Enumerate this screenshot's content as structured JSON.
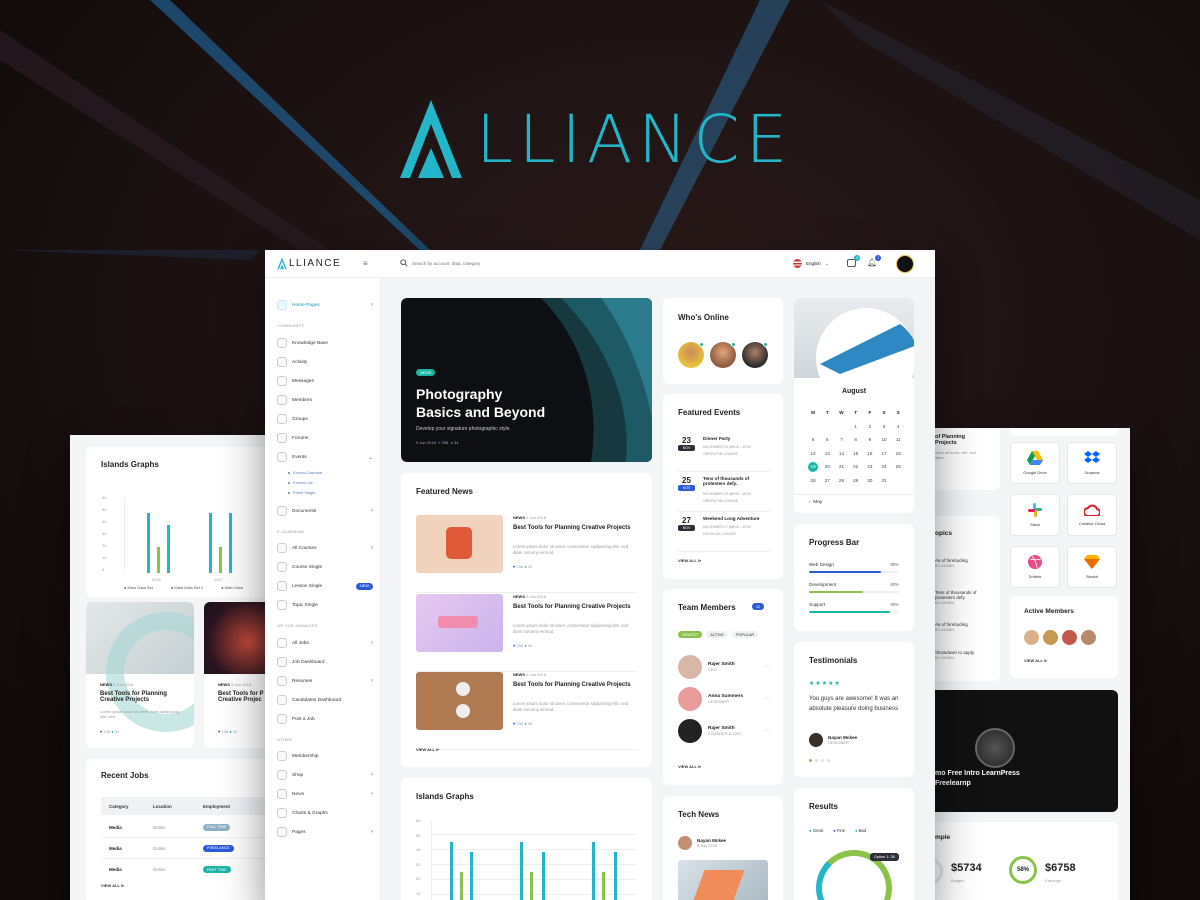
{
  "brand": {
    "name": "ALLIANCE",
    "accent": "#23b5c8"
  },
  "topbar": {
    "search_placeholder": "Search by account, data, category",
    "language": "English",
    "notif_badges": [
      "2",
      "1"
    ]
  },
  "sidebar": {
    "home": "Home Pages",
    "sections": [
      {
        "title": "COMMUNITY"
      },
      {
        "title": "E-LEARNING"
      },
      {
        "title": "WP JOB MANAGER"
      },
      {
        "title": "OTHER"
      }
    ],
    "community": [
      "Knowledge Base",
      "Activity",
      "Messages",
      "Members",
      "Groups",
      "Forums",
      "Events"
    ],
    "events_sub": [
      "Events Calendar",
      "Events List",
      "Event Single"
    ],
    "documents": "Documents",
    "elearning": [
      "All Courses",
      "Course Single",
      "Lesson Single",
      "Topic Single"
    ],
    "lesson_badge": "NEW",
    "jobs": [
      "All Jobs",
      "Job Dashboard",
      "Resumes",
      "Candidates Dashboard",
      "Post a Job"
    ],
    "other": [
      "Membership",
      "Shop",
      "News",
      "Charts & Graphs",
      "Pages"
    ]
  },
  "hero": {
    "tag": "NEWS",
    "title1": "Photography",
    "title2": "Basics and Beyond",
    "subtitle": "Develop your signature photographic style.",
    "date": "9 Jun 2018",
    "likes": "256",
    "comments": "34"
  },
  "featured_news": {
    "title": "Featured News",
    "items": [
      {
        "cat": "NEWS",
        "date": "9 Jun 2018",
        "title": "Best Tools for Planning Creative Projects",
        "text": "Lorem ipsum dolor sit amet, consectetur sadipscing elitr, sed diam nonumy eirmod.",
        "likes": "256",
        "comments": "34"
      },
      {
        "cat": "NEWS",
        "date": "9 Jun 2018",
        "title": "Best Tools for Planning Creative Projects",
        "text": "Lorem ipsum dolor sit amet, consectetur sadipscing elitr, sed diam nonumy eirmod.",
        "likes": "256",
        "comments": "34"
      },
      {
        "cat": "NEWS",
        "date": "9 Jun 2018",
        "title": "Best Tools for Planning Creative Projects",
        "text": "Lorem ipsum dolor sit amet, consectetur sadipscing elitr, sed diam nonumy eirmod.",
        "likes": "256",
        "comments": "36"
      }
    ],
    "view_all": "VIEW ALL"
  },
  "islands_graph": {
    "title": "Islands Graphs",
    "yticks": [
      "60",
      "50",
      "40",
      "30",
      "20",
      "10",
      "0"
    ]
  },
  "who_online": {
    "title": "Who's Online"
  },
  "featured_events": {
    "title": "Featured Events",
    "items": [
      {
        "day": "23",
        "mon": "NOV",
        "title": "Dinner Party",
        "meta1": "NOVEMBER 23 @8:00 - 10:00",
        "meta2": "GREEN PIN LOUNGE"
      },
      {
        "day": "25",
        "mon": "NOV",
        "title": "Tens of thousands of protesters defy.",
        "meta1": "NOVEMBER 25 @8:00 - 10:00",
        "meta2": "GREEN PIN LOUNGE"
      },
      {
        "day": "27",
        "mon": "NOV",
        "title": "Weekend Long Adventure",
        "meta1": "NOVEMBER 27 @8:00 - 10:00",
        "meta2": "DOUGLAS LOUNGE"
      }
    ],
    "view_all": "VIEW ALL"
  },
  "team": {
    "title": "Team Members",
    "count": "12",
    "tabs": [
      "NEWEST",
      "ACTIVE",
      "POPULAR"
    ],
    "members": [
      {
        "name": "Rajer Smith",
        "role": "CEO"
      },
      {
        "name": "Anna Summers",
        "role": "DESIGNER"
      },
      {
        "name": "Rajer Smith",
        "role": "FOUNDER & CEO"
      }
    ],
    "view_all": "VIEW ALL"
  },
  "tech_news": {
    "title": "Tech News",
    "author": "Nayan Mckee",
    "date": "9 Jun 2018"
  },
  "calendar": {
    "month": "August",
    "days": [
      "M",
      "T",
      "W",
      "T",
      "F",
      "S",
      "S"
    ],
    "rows": [
      [
        "",
        "",
        "",
        "1",
        "2",
        "3",
        "4"
      ],
      [
        "5",
        "6",
        "7",
        "8",
        "9",
        "10",
        "11"
      ],
      [
        "12",
        "13",
        "14",
        "15",
        "16",
        "17",
        "18"
      ],
      [
        "19",
        "20",
        "21",
        "22",
        "23",
        "24",
        "25"
      ],
      [
        "26",
        "27",
        "28",
        "29",
        "30",
        "31",
        ""
      ]
    ],
    "prev": "May",
    "selected": "19"
  },
  "progress": {
    "title": "Progress Bar",
    "items": [
      {
        "label": "Web Design",
        "pct": "80%",
        "value": 0.8,
        "color": "#2c5ad8"
      },
      {
        "label": "Development",
        "pct": "60%",
        "value": 0.6,
        "color": "#8bc34a"
      },
      {
        "label": "Support",
        "pct": "90%",
        "value": 0.9,
        "color": "#1bb5a6"
      }
    ]
  },
  "testimonials": {
    "title": "Testimonials",
    "stars": "★★★★★",
    "quote": "You guys are awesome! It was an absolute pleasure doing business",
    "author": "Nayan Mckee",
    "role": "DESIGNER"
  },
  "results": {
    "title": "Results",
    "legend": [
      "Great",
      "Fine",
      "Bad"
    ],
    "tooltip": "Option 1: 38"
  },
  "left_panel": {
    "graph_title": "Islands Graphs",
    "yticks": [
      "60",
      "50",
      "40",
      "30",
      "20",
      "10",
      "0"
    ],
    "xlabels": [
      "2016",
      "2017"
    ],
    "legend": [
      "Main Data Set",
      "Main Data Set 2",
      "Main Data"
    ],
    "news": [
      {
        "cat": "NEWS",
        "date": "9 Jun 2018",
        "title": "Best Tools for Planning Creative Projects",
        "text": "Lorem ipsum dolor sit amet, cons sadipscing elitr, sed",
        "likes": "135",
        "comments": "34"
      },
      {
        "cat": "NEWS",
        "date": "9 Jun 2018",
        "title": "Best Tools for P Creative Projec",
        "likes": "135",
        "comments": "34"
      }
    ],
    "jobs_title": "Recent Jobs",
    "jobs_head": [
      "Category",
      "Location",
      "Employment"
    ],
    "jobs": [
      {
        "cat": "Media",
        "loc": "Dallas",
        "type": "FULL TIME",
        "color": "#8fb0c6"
      },
      {
        "cat": "Media",
        "loc": "Dallas",
        "type": "FREELANCE",
        "color": "#2c5ad8"
      },
      {
        "cat": "Media",
        "loc": "Dallas",
        "type": "PART TIME",
        "color": "#1bb5a6"
      }
    ],
    "view_all": "VIEW ALL"
  },
  "right_panel": {
    "apps": [
      "Google Drive",
      "Dropbox",
      "Slack",
      "Creative Cloud",
      "Dribble",
      "Sketch"
    ],
    "active_title": "Active Members",
    "view_all": "VIEW ALL",
    "topics_title": "opics",
    "topics": [
      {
        "t": "As of foreboding",
        "m": "BY ADMIN"
      },
      {
        "t": "Tens of thousands of protesters defy.",
        "m": "BY ADMIN"
      },
      {
        "t": "As of foreboding",
        "m": "BY ADMIN"
      },
      {
        "t": "Showdown to apply.",
        "m": "BY ADMIN"
      }
    ],
    "topic_top": "of Planning Projects",
    "topic_top_text": "dolor sit amet, elitr, sed diam",
    "video_title": "mo Free Intro LearnPress",
    "video_sub": "Freelearnp",
    "sample_title": "mple",
    "stat1": "$5734",
    "stat1_label": "Budget",
    "stat2_pct": "58%",
    "stat2": "$6758",
    "stat2_label": "Earnings"
  }
}
